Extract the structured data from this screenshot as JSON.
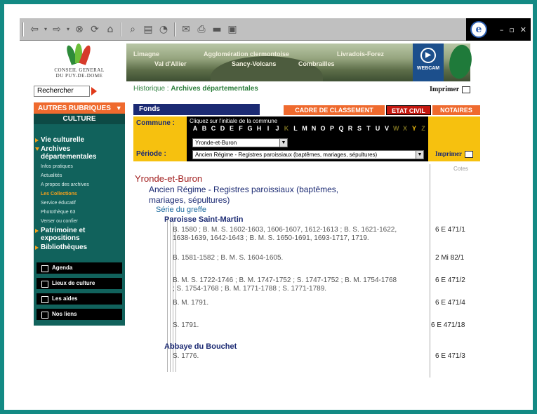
{
  "browser": {
    "toolbar_icons": [
      "back-icon",
      "forward-icon",
      "stop-icon",
      "refresh-icon",
      "home-icon",
      "search-icon",
      "favorites-icon",
      "history-icon",
      "mail-icon",
      "print-icon",
      "edit-icon",
      "discuss-icon"
    ],
    "window_controls": [
      "–",
      "🗗",
      "✕"
    ]
  },
  "header": {
    "logo_line1": "CONSEIL GENERAL",
    "logo_line2": "DU PUY-DE-DOME",
    "banner_labels": [
      "Limagne",
      "Agglomération clermontoise",
      "Livradois-Forez",
      "Val d'Allier",
      "Sancy-Volcans",
      "Combrailles"
    ],
    "webcam_label": "WEBCAM",
    "search_value": "Rechercher",
    "breadcrumb_prefix": "Historique : ",
    "breadcrumb_current": "Archives départementales",
    "print_label": "Imprimer"
  },
  "sidebar": {
    "autres_label": "AUTRES RUBRIQUES",
    "culture_label": "CULTURE",
    "nav": [
      {
        "label": "Vie culturelle"
      },
      {
        "label": "Archives départementales"
      }
    ],
    "sub": [
      "Infos pratiques",
      "Actualités",
      "A propos des archives",
      "Les Collections",
      "Service éducatif",
      "Photothèque 63",
      "Verser ou confier"
    ],
    "nav2": [
      {
        "label": "Patrimoine et expositions"
      },
      {
        "label": "Bibliothèques"
      }
    ],
    "buttons": [
      "Agenda",
      "Lieux de culture",
      "Les aides",
      "Nos liens"
    ]
  },
  "main": {
    "fonds_label": "Fonds",
    "tabs": [
      "CADRE DE CLASSEMENT",
      "ETAT CIVIL",
      "NOTAIRES"
    ],
    "commune_label": "Commune :",
    "periode_label": "Période :",
    "hint": "Cliquez sur l'initiale de la commune",
    "letters": [
      "A",
      "B",
      "C",
      "D",
      "E",
      "F",
      "G",
      "H",
      "I",
      "J",
      "K",
      "L",
      "M",
      "N",
      "O",
      "P",
      "Q",
      "R",
      "S",
      "T",
      "U",
      "V",
      "W",
      "X",
      "Y",
      "Z"
    ],
    "commune_value": "Yronde-et-Buron",
    "periode_value": "Ancien Régime - Registres paroissiaux (baptêmes, mariages, sépultures)",
    "print_label": "Imprimer"
  },
  "results": {
    "cote_header": "Cotes",
    "commune": "Yronde-et-Buron",
    "period_line1": "Ancien Régime - Registres paroissiaux (baptêmes,",
    "period_line2": "mariages, sépultures)",
    "series": "Série du greffe",
    "parish1": "Paroisse Saint-Martin",
    "records": [
      {
        "text": "B. 1580 ; B. M. S. 1602-1603, 1606-1607, 1612-1613 ; B. S. 1621-1622, 1638-1639, 1642-1643 ; B. M. S. 1650-1691, 1693-1717, 1719.",
        "cote": "6 E 471/1"
      },
      {
        "text": "B. 1581-1582 ; B. M. S. 1604-1605.",
        "cote": "2 Mi 82/1"
      },
      {
        "text": "B. M. S. 1722-1746 ; B. M. 1747-1752 ; S. 1747-1752 ; B. M. 1754-1768 ; S. 1754-1768 ; B. M. 1771-1788 ; S. 1771-1789.",
        "cote": "6 E 471/2"
      },
      {
        "text": "B. M. 1791.",
        "cote": "6 E 471/4"
      },
      {
        "text": "S. 1791.",
        "cote": "6 E 471/18"
      }
    ],
    "parish2": "Abbaye du Bouchet",
    "records2": [
      {
        "text": "S. 1776.",
        "cote": "6 E 471/3"
      }
    ]
  }
}
